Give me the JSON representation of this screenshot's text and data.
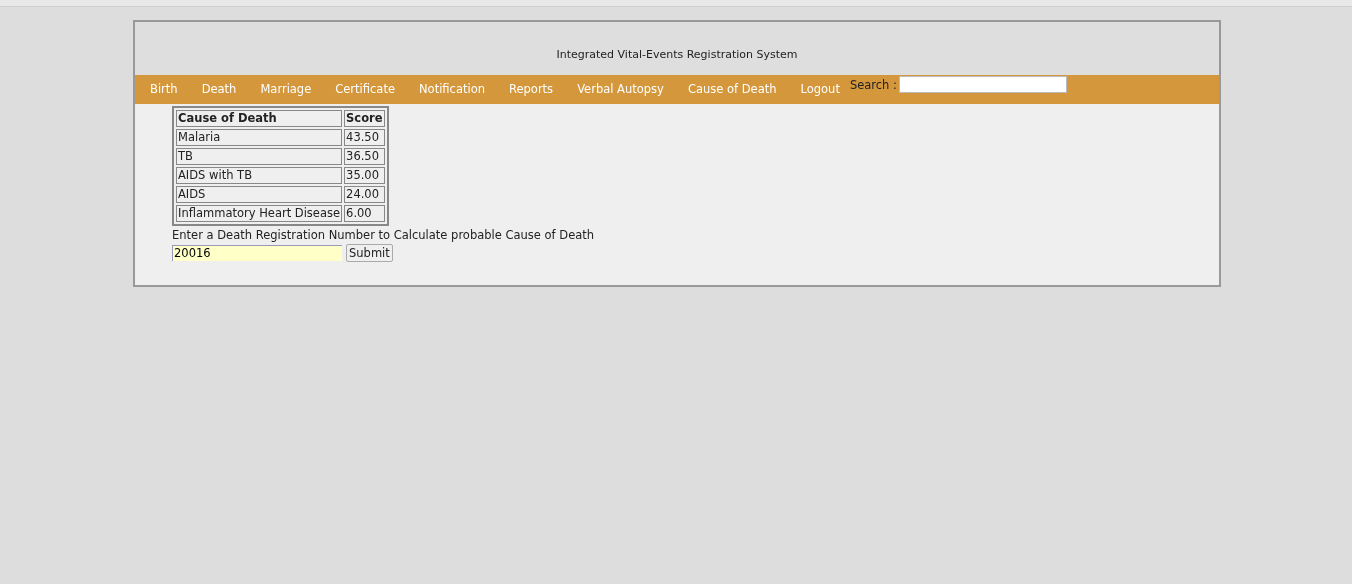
{
  "header": {
    "title": "Integrated Vital-Events Registration System"
  },
  "nav": {
    "items": [
      "Birth",
      "Death",
      "Marriage",
      "Certificate",
      "Notification",
      "Reports",
      "Verbal Autopsy",
      "Cause of Death",
      "Logout"
    ],
    "search_label": "Search :"
  },
  "table": {
    "columns": [
      "Cause of Death",
      "Score"
    ],
    "rows": [
      [
        "Malaria",
        "43.50"
      ],
      [
        "TB",
        "36.50"
      ],
      [
        "AIDS with TB",
        "35.00"
      ],
      [
        "AIDS",
        "24.00"
      ],
      [
        "Inflammatory Heart Disease",
        "6.00"
      ]
    ]
  },
  "form": {
    "prompt": "Enter a Death Registration Number to Calculate probable Cause of Death",
    "value": "20016",
    "button": "Submit"
  }
}
